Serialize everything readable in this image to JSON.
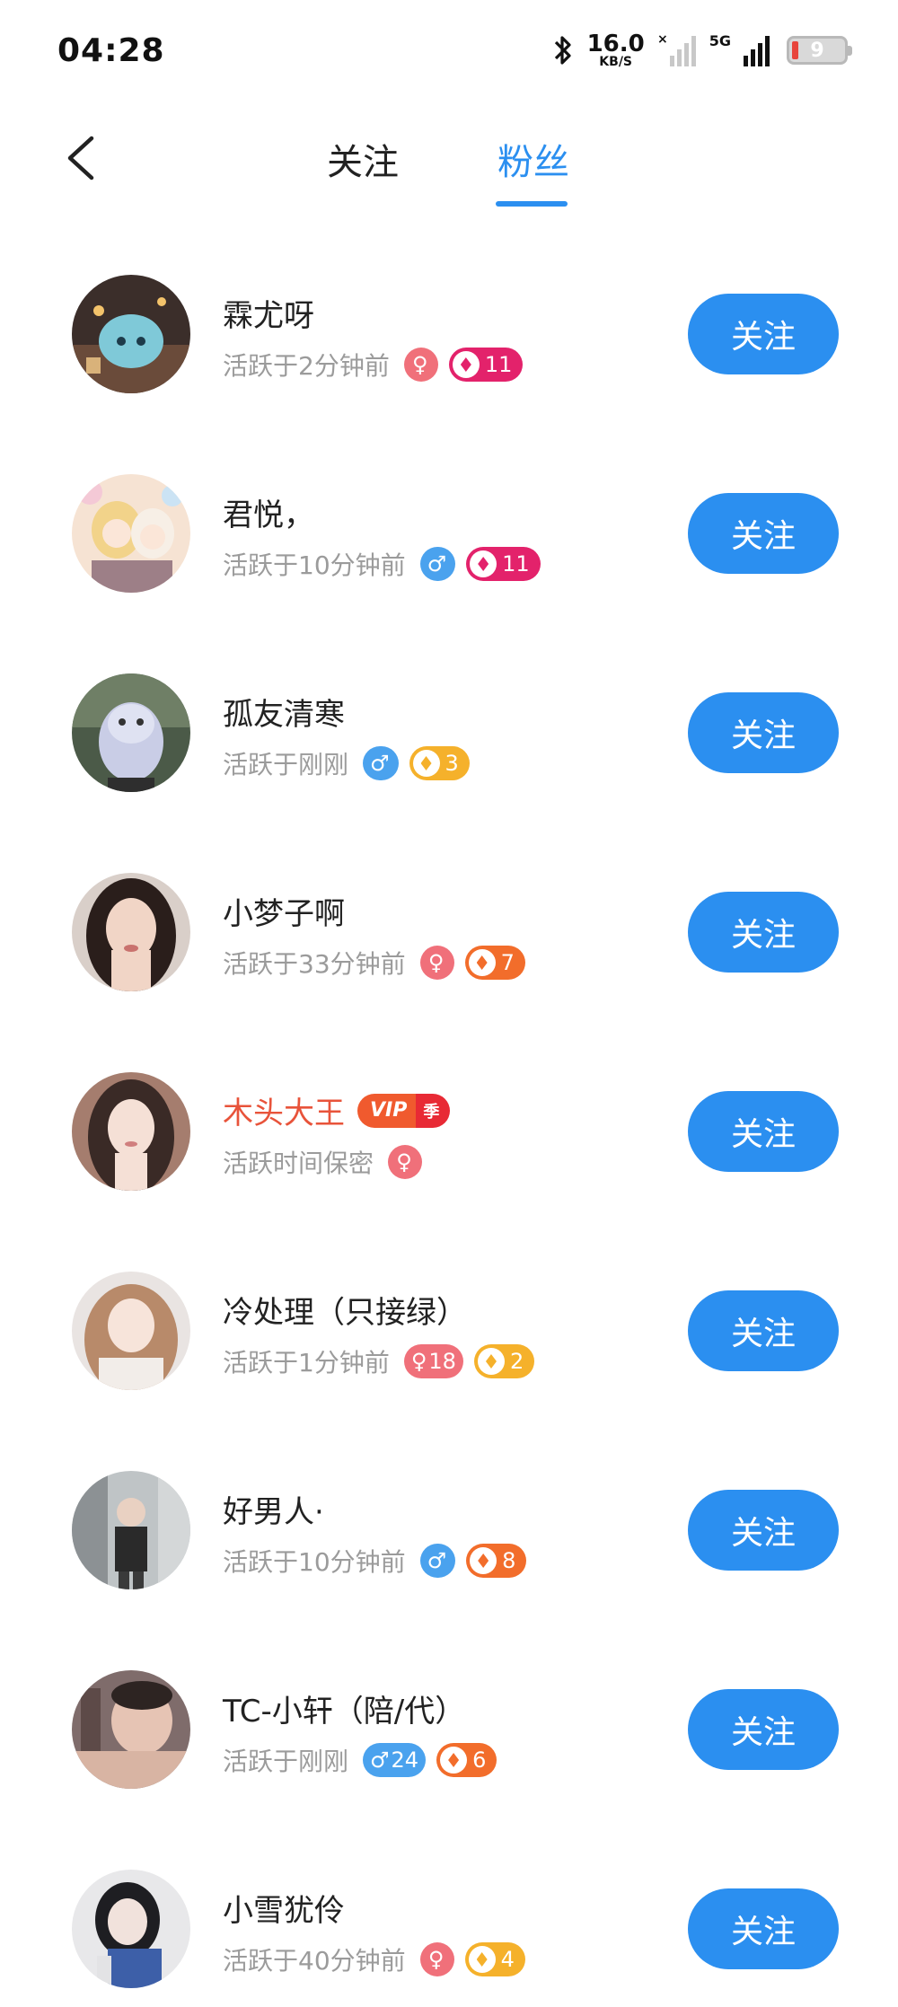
{
  "status_bar": {
    "time": "04:28",
    "net_speed": "16.0",
    "net_unit": "KB/S",
    "network": "5G",
    "battery": "9"
  },
  "nav": {
    "back_icon": "chevron-left-icon",
    "tabs": [
      {
        "label": "关注",
        "active": false
      },
      {
        "label": "粉丝",
        "active": true
      }
    ]
  },
  "colors": {
    "accent": "#2b8ff0",
    "female": "#f0707a",
    "male": "#4aa2ee",
    "vip_name": "#e8533a"
  },
  "fans": [
    {
      "name": "霖尤呀",
      "active": "活跃于2分钟前",
      "gender": "female",
      "gender_label": "",
      "level": "11",
      "level_color": "pink",
      "vip": false,
      "button": "关注"
    },
    {
      "name": "君悦，",
      "active": "活跃于10分钟前",
      "gender": "male",
      "gender_label": "",
      "level": "11",
      "level_color": "pink",
      "vip": false,
      "button": "关注"
    },
    {
      "name": "孤友清寒",
      "active": "活跃于刚刚",
      "gender": "male",
      "gender_label": "",
      "level": "3",
      "level_color": "yellow",
      "vip": false,
      "button": "关注"
    },
    {
      "name": "小梦子啊",
      "active": "活跃于33分钟前",
      "gender": "female",
      "gender_label": "",
      "level": "7",
      "level_color": "orange",
      "vip": false,
      "button": "关注"
    },
    {
      "name": "木头大王",
      "active": "活跃时间保密",
      "gender": "female",
      "gender_label": "",
      "level": "",
      "level_color": "",
      "vip": true,
      "vip_text": "VIP",
      "vip_tag": "季",
      "button": "关注"
    },
    {
      "name": "冷处理（只接绿）",
      "active": "活跃于1分钟前",
      "gender": "female",
      "gender_label": "18",
      "level": "2",
      "level_color": "yellow",
      "vip": false,
      "button": "关注"
    },
    {
      "name": "好男人·",
      "active": "活跃于10分钟前",
      "gender": "male",
      "gender_label": "",
      "level": "8",
      "level_color": "orange",
      "vip": false,
      "button": "关注"
    },
    {
      "name": "TC-小轩（陪/代）",
      "active": "活跃于刚刚",
      "gender": "male",
      "gender_label": "24",
      "level": "6",
      "level_color": "orange",
      "vip": false,
      "button": "关注"
    },
    {
      "name": "小雪犹伶",
      "active": "活跃于40分钟前",
      "gender": "female",
      "gender_label": "",
      "level": "4",
      "level_color": "yellow",
      "vip": false,
      "button": "关注"
    }
  ]
}
